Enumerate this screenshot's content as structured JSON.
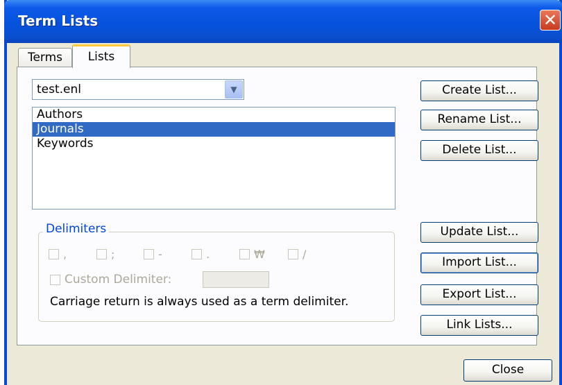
{
  "window": {
    "title": "Term Lists",
    "close_glyph": "✕"
  },
  "tabs": [
    {
      "label": "Terms"
    },
    {
      "label": "Lists"
    }
  ],
  "combo": {
    "value": "test.enl",
    "arrow_glyph": "▼"
  },
  "lists": [
    {
      "label": "Authors",
      "selected": false
    },
    {
      "label": "Journals",
      "selected": true
    },
    {
      "label": "Keywords",
      "selected": false
    }
  ],
  "delimiters": {
    "legend": "Delimiters",
    "items": [
      {
        "symbol": ","
      },
      {
        "symbol": ";"
      },
      {
        "symbol": "-"
      },
      {
        "symbol": "."
      },
      {
        "symbol": "₩"
      },
      {
        "symbol": "/"
      }
    ],
    "custom_label": "Custom Delimiter:",
    "custom_value": "",
    "note": "Carriage return is always used as a term delimiter."
  },
  "buttons": {
    "create": "Create List...",
    "rename": "Rename List...",
    "delete": "Delete List...",
    "update": "Update List...",
    "import": "Import List...",
    "export": "Export List...",
    "link": "Link Lists...",
    "close": "Close"
  },
  "colors": {
    "titlebar": "#0552dc",
    "selection": "#316ac5",
    "tab_highlight": "#ffc83c",
    "group_legend": "#0046d5"
  }
}
